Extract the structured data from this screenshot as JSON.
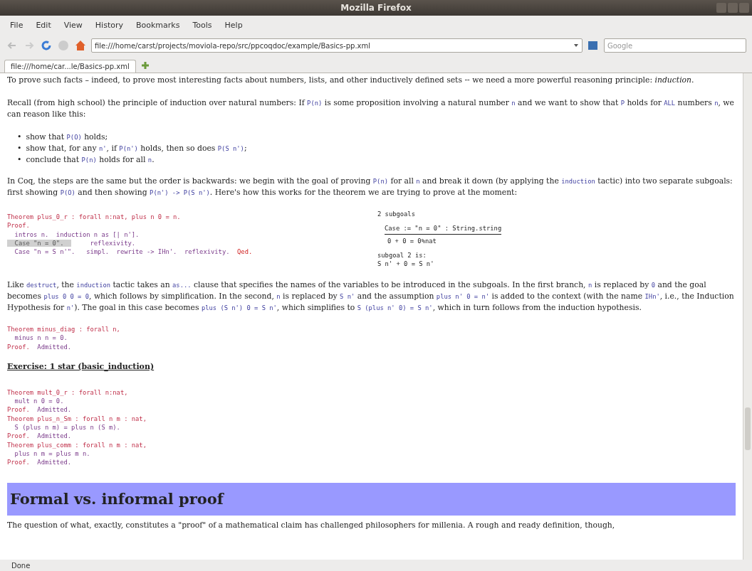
{
  "window": {
    "title": "Mozilla Firefox"
  },
  "menu": [
    "File",
    "Edit",
    "View",
    "History",
    "Bookmarks",
    "Tools",
    "Help"
  ],
  "address_bar": {
    "value": "file:///home/carst/projects/moviola-repo/src/ppcoqdoc/example/Basics-pp.xml"
  },
  "search": {
    "placeholder": "Google"
  },
  "tabs": [
    {
      "label": "file:///home/car...le/Basics-pp.xml",
      "selected": true
    }
  ],
  "content": [
    {
      "kind": "para",
      "segments": [
        {
          "kind": "txt",
          "text": "To prove such facts – indeed, to prove most interesting facts about numbers, lists, and other inductively defined sets -- we need a more powerful reasoning principle: "
        },
        {
          "kind": "em",
          "text": "induction"
        },
        {
          "kind": "txt",
          "text": "."
        }
      ]
    },
    {
      "kind": "para",
      "segments": [
        {
          "kind": "txt",
          "text": "Recall (from high school) the principle of induction over natural numbers: If "
        },
        {
          "kind": "code",
          "text": "P(n)"
        },
        {
          "kind": "txt",
          "text": " is some proposition involving a natural number "
        },
        {
          "kind": "code",
          "text": "n"
        },
        {
          "kind": "txt",
          "text": " and we want to show that "
        },
        {
          "kind": "code",
          "text": "P"
        },
        {
          "kind": "txt",
          "text": " holds for "
        },
        {
          "kind": "code",
          "text": "ALL"
        },
        {
          "kind": "txt",
          "text": " numbers "
        },
        {
          "kind": "code",
          "text": "n"
        },
        {
          "kind": "txt",
          "text": ", we can reason like this:"
        }
      ]
    },
    {
      "kind": "list",
      "items": [
        {
          "bullet": "•",
          "segments": [
            {
              "kind": "txt",
              "text": "show that "
            },
            {
              "kind": "code",
              "text": "P(O)"
            },
            {
              "kind": "txt",
              "text": " holds;"
            }
          ]
        },
        {
          "bullet": "•",
          "segments": [
            {
              "kind": "txt",
              "text": "show that, for any "
            },
            {
              "kind": "code",
              "text": "n'"
            },
            {
              "kind": "txt",
              "text": ", if "
            },
            {
              "kind": "code",
              "text": "P(n')"
            },
            {
              "kind": "txt",
              "text": " holds, then so does "
            },
            {
              "kind": "code",
              "text": "P(S n')"
            },
            {
              "kind": "txt",
              "text": ";"
            }
          ]
        },
        {
          "bullet": "•",
          "segments": [
            {
              "kind": "txt",
              "text": "conclude that "
            },
            {
              "kind": "code",
              "text": "P(n)"
            },
            {
              "kind": "txt",
              "text": " holds for all "
            },
            {
              "kind": "code",
              "text": "n"
            },
            {
              "kind": "txt",
              "text": "."
            }
          ]
        }
      ]
    },
    {
      "kind": "para",
      "segments": [
        {
          "kind": "txt",
          "text": "In Coq, the steps are the same but the order is backwards: we begin with the goal of proving "
        },
        {
          "kind": "code",
          "text": "P(n)"
        },
        {
          "kind": "txt",
          "text": " for all "
        },
        {
          "kind": "code",
          "text": "n"
        },
        {
          "kind": "txt",
          "text": " and break it down (by applying the "
        },
        {
          "kind": "code",
          "text": "induction"
        },
        {
          "kind": "txt",
          "text": " tactic) into two separate subgoals: first showing "
        },
        {
          "kind": "code",
          "text": "P(O)"
        },
        {
          "kind": "txt",
          "text": " and then showing "
        },
        {
          "kind": "code",
          "text": "P(n') -> P(S n')"
        },
        {
          "kind": "txt",
          "text": ". Here's how this works for the theorem we are trying to prove at the moment:"
        }
      ]
    },
    {
      "kind": "proof",
      "code": [
        [
          {
            "kind": "kw",
            "text": "Theorem plus_0_r : forall n:nat, plus n 0 = n."
          }
        ],
        [
          {
            "kind": "kw",
            "text": "Proof."
          }
        ],
        [
          {
            "kind": "plain",
            "text": "  intros n.  induction n as [| n']."
          }
        ],
        [
          {
            "kind": "selection",
            "text": "  Case \"n = 0\".  "
          },
          {
            "kind": "plain",
            "text": "     reflexivity."
          }
        ],
        [
          {
            "kind": "plain",
            "text": "  Case \"n = S n'\".   simpl.  rewrite -> IHn'.  reflexivity.  "
          },
          {
            "kind": "qed",
            "text": "Qed."
          }
        ]
      ],
      "goals": {
        "header": "2 subgoals",
        "hypothesis": "Case := \"n = 0\" : String.string",
        "goal": "0 + 0 = 0%nat",
        "subgoal_label": "subgoal 2 is:",
        "subgoal": "S n' + 0 = S n'"
      }
    },
    {
      "kind": "para",
      "segments": [
        {
          "kind": "txt",
          "text": "Like "
        },
        {
          "kind": "code",
          "text": "destruct"
        },
        {
          "kind": "txt",
          "text": ", the "
        },
        {
          "kind": "code",
          "text": "induction"
        },
        {
          "kind": "txt",
          "text": " tactic takes an "
        },
        {
          "kind": "code",
          "text": "as..."
        },
        {
          "kind": "txt",
          "text": " clause that specifies the names of the variables to be introduced in the subgoals. In the first branch, "
        },
        {
          "kind": "code",
          "text": "n"
        },
        {
          "kind": "txt",
          "text": " is replaced by "
        },
        {
          "kind": "code",
          "text": "0"
        },
        {
          "kind": "txt",
          "text": " and the goal becomes "
        },
        {
          "kind": "code",
          "text": "plus 0 0 = 0"
        },
        {
          "kind": "txt",
          "text": ", which follows by simplification. In the second, "
        },
        {
          "kind": "code",
          "text": "n"
        },
        {
          "kind": "txt",
          "text": " is replaced by "
        },
        {
          "kind": "code",
          "text": "S n'"
        },
        {
          "kind": "txt",
          "text": " and the assumption "
        },
        {
          "kind": "code",
          "text": "plus n' 0 = n'"
        },
        {
          "kind": "txt",
          "text": " is added to the context (with the name "
        },
        {
          "kind": "code",
          "text": "IHn'"
        },
        {
          "kind": "txt",
          "text": ", i.e., the Induction Hypothesis for "
        },
        {
          "kind": "code",
          "text": "n'"
        },
        {
          "kind": "txt",
          "text": "). The goal in this case becomes "
        },
        {
          "kind": "code",
          "text": "plus (S n') 0 = S n'"
        },
        {
          "kind": "txt",
          "text": ", which simplifies to "
        },
        {
          "kind": "code",
          "text": "S (plus n' 0) = S n'"
        },
        {
          "kind": "txt",
          "text": ", which in turn follows from the induction hypothesis."
        }
      ]
    },
    {
      "kind": "code",
      "lines": [
        [
          {
            "kind": "kw",
            "text": "Theorem minus_diag : forall n,"
          }
        ],
        [
          {
            "kind": "plain",
            "text": "  minus n n = 0."
          }
        ],
        [
          {
            "kind": "kw",
            "text": "Proof."
          },
          {
            "kind": "plain",
            "text": "  Admitted."
          }
        ]
      ]
    },
    {
      "kind": "exercise",
      "text": "Exercise: 1 star (basic_induction)"
    },
    {
      "kind": "code",
      "lines": [
        [
          {
            "kind": "kw",
            "text": "Theorem mult_0_r : forall n:nat,"
          }
        ],
        [
          {
            "kind": "plain",
            "text": "  mult n 0 = 0."
          }
        ],
        [
          {
            "kind": "kw",
            "text": "Proof."
          },
          {
            "kind": "plain",
            "text": "  Admitted."
          }
        ],
        [
          {
            "kind": "kw",
            "text": "Theorem plus_n_Sm : forall n m : nat,"
          }
        ],
        [
          {
            "kind": "plain",
            "text": "  S (plus n m) = plus n (S m)."
          }
        ],
        [
          {
            "kind": "kw",
            "text": "Proof."
          },
          {
            "kind": "plain",
            "text": "  Admitted."
          }
        ],
        [
          {
            "kind": "kw",
            "text": "Theorem plus_comm : forall n m : nat,"
          }
        ],
        [
          {
            "kind": "plain",
            "text": "  plus n m = plus m n."
          }
        ],
        [
          {
            "kind": "kw",
            "text": "Proof."
          },
          {
            "kind": "plain",
            "text": "  Admitted."
          }
        ]
      ]
    },
    {
      "kind": "heading",
      "text": "Formal vs. informal proof"
    },
    {
      "kind": "para",
      "segments": [
        {
          "kind": "txt",
          "text": "The question of what, exactly, constitutes a \"proof\" of a mathematical claim has challenged philosophers for millenia. A rough and ready definition, though,"
        }
      ]
    }
  ],
  "status_bar": "Done"
}
